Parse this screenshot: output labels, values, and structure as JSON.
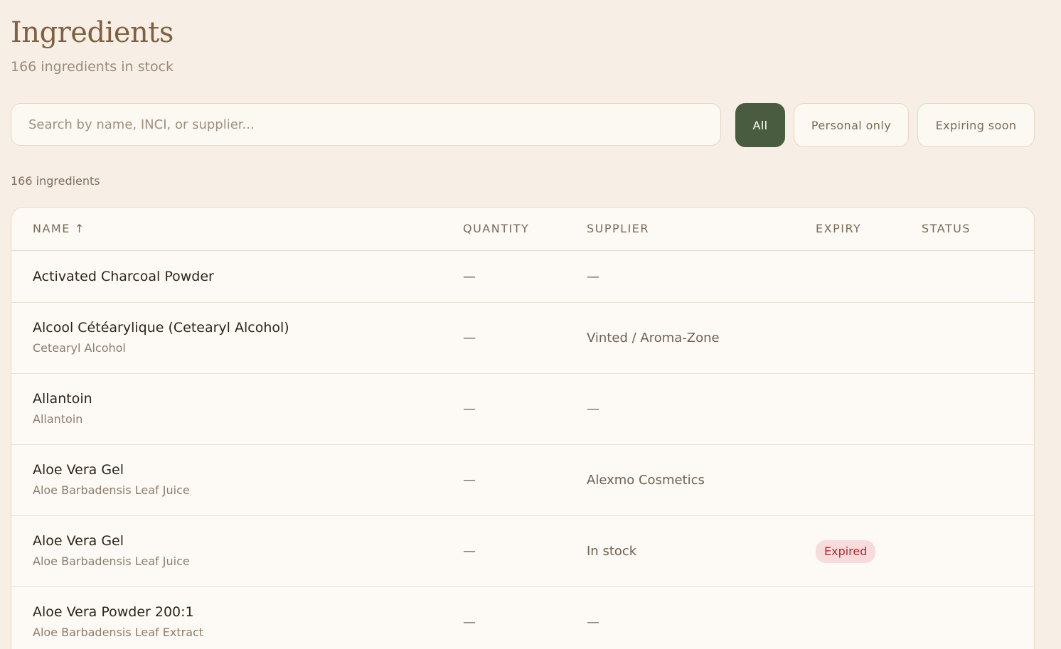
{
  "header": {
    "title": "Ingredients",
    "subtitle": "166 ingredients in stock"
  },
  "search": {
    "placeholder": "Search by name, INCI, or supplier...",
    "value": ""
  },
  "filters": {
    "all": "All",
    "personal": "Personal only",
    "expiring": "Expiring soon",
    "active": "All"
  },
  "count_label": "166 ingredients",
  "table": {
    "columns": {
      "name": "NAME",
      "name_sort_icon": "↑",
      "quantity": "QUANTITY",
      "supplier": "SUPPLIER",
      "expiry": "EXPIRY",
      "status": "STATUS"
    },
    "rows": [
      {
        "name": "Activated Charcoal Powder",
        "inci": "",
        "quantity": "—",
        "supplier": "—",
        "expiry": "",
        "status": ""
      },
      {
        "name": "Alcool Cétéarylique (Cetearyl Alcohol)",
        "inci": "Cetearyl Alcohol",
        "quantity": "—",
        "supplier": "Vinted / Aroma-Zone",
        "expiry": "",
        "status": ""
      },
      {
        "name": "Allantoin",
        "inci": "Allantoin",
        "quantity": "—",
        "supplier": "—",
        "expiry": "",
        "status": ""
      },
      {
        "name": "Aloe Vera Gel",
        "inci": "Aloe Barbadensis Leaf Juice",
        "quantity": "—",
        "supplier": "Alexmo Cosmetics",
        "expiry": "",
        "status": ""
      },
      {
        "name": "Aloe Vera Gel",
        "inci": "Aloe Barbadensis Leaf Juice",
        "quantity": "—",
        "supplier": "In stock",
        "expiry": "Expired",
        "status": ""
      },
      {
        "name": "Aloe Vera Powder 200:1",
        "inci": "Aloe Barbadensis Leaf Extract",
        "quantity": "—",
        "supplier": "—",
        "expiry": "",
        "status": ""
      }
    ]
  },
  "colors": {
    "background": "#f7efe6",
    "accent": "#4a5c40",
    "title": "#80603f",
    "expired_badge_bg": "#f8dcdc",
    "expired_badge_text": "#b3262e"
  }
}
